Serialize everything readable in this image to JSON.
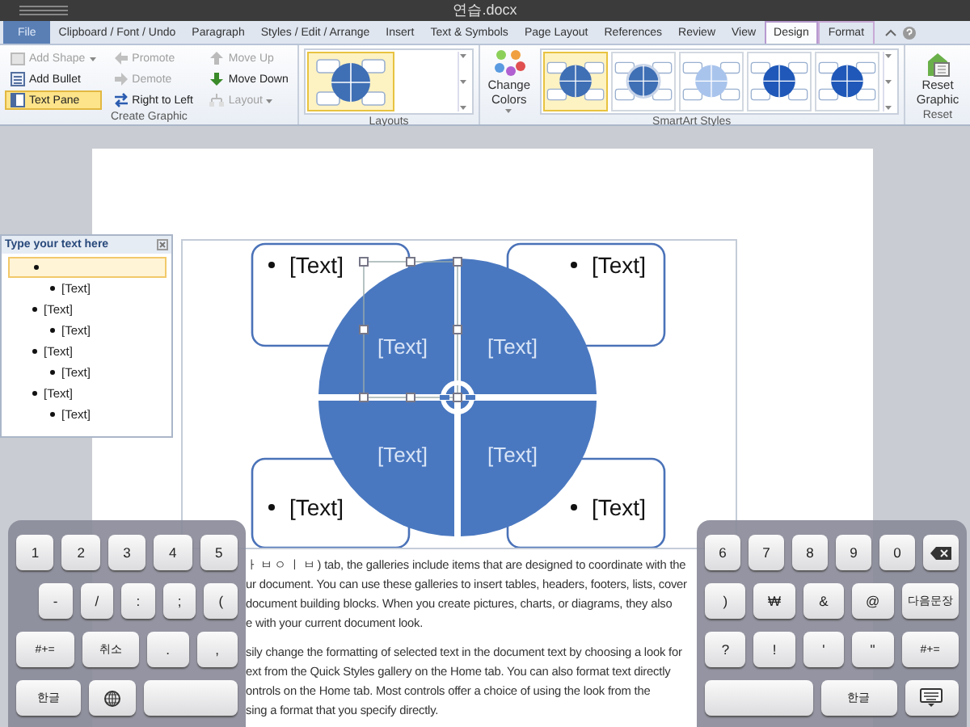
{
  "window": {
    "title": "연습.docx"
  },
  "tabs": [
    {
      "label": "File",
      "selected": false,
      "kind": "file"
    },
    {
      "label": "Clipboard / Font / Undo",
      "selected": false,
      "kind": "normal"
    },
    {
      "label": "Paragraph",
      "selected": false,
      "kind": "normal"
    },
    {
      "label": "Styles / Edit / Arrange",
      "selected": false,
      "kind": "normal"
    },
    {
      "label": "Insert",
      "selected": false,
      "kind": "normal"
    },
    {
      "label": "Text & Symbols",
      "selected": false,
      "kind": "normal"
    },
    {
      "label": "Page Layout",
      "selected": false,
      "kind": "normal"
    },
    {
      "label": "References",
      "selected": false,
      "kind": "normal"
    },
    {
      "label": "Review",
      "selected": false,
      "kind": "normal"
    },
    {
      "label": "View",
      "selected": false,
      "kind": "normal"
    },
    {
      "label": "Design",
      "selected": true,
      "kind": "contextual"
    },
    {
      "label": "Format",
      "selected": false,
      "kind": "contextual"
    }
  ],
  "create_graphic": {
    "label": "Create Graphic",
    "columns": [
      [
        {
          "label": "Add Shape",
          "kind": "shape",
          "disabled": true,
          "dropdown": true,
          "active": false
        },
        {
          "label": "Add Bullet",
          "kind": "bullet",
          "disabled": false,
          "dropdown": false,
          "active": false
        },
        {
          "label": "Text Pane",
          "kind": "pane",
          "disabled": false,
          "dropdown": false,
          "active": true
        }
      ],
      [
        {
          "label": "Promote",
          "kind": "left",
          "disabled": true,
          "dropdown": false,
          "active": false
        },
        {
          "label": "Demote",
          "kind": "right",
          "disabled": true,
          "dropdown": false,
          "active": false
        },
        {
          "label": "Right to Left",
          "kind": "swap",
          "disabled": false,
          "dropdown": false,
          "active": false
        }
      ],
      [
        {
          "label": "Move Up",
          "kind": "up",
          "disabled": true,
          "dropdown": false,
          "active": false
        },
        {
          "label": "Move Down",
          "kind": "down",
          "disabled": false,
          "dropdown": false,
          "active": false
        },
        {
          "label": "Layout",
          "kind": "org",
          "disabled": true,
          "dropdown": true,
          "active": false
        }
      ]
    ]
  },
  "layouts": {
    "label": "Layouts",
    "items": [
      {
        "selected": true
      }
    ]
  },
  "smartart_styles": {
    "label": "SmartArt Styles",
    "change_colors": "Change Colors",
    "styles": [
      {
        "selected": true,
        "kind": "flat"
      },
      {
        "selected": false,
        "kind": "ring"
      },
      {
        "selected": false,
        "kind": "light"
      },
      {
        "selected": false,
        "kind": "dark"
      },
      {
        "selected": false,
        "kind": "dark"
      }
    ]
  },
  "reset": {
    "label": "Reset",
    "button": "Reset Graphic"
  },
  "text_pane": {
    "title": "Type your text here",
    "items": [
      {
        "selected": true,
        "children": [
          {
            "text": "[Text]"
          }
        ]
      },
      {
        "text": "[Text]",
        "selected": false,
        "children": [
          {
            "text": "[Text]"
          }
        ]
      },
      {
        "text": "[Text]",
        "selected": false,
        "children": [
          {
            "text": "[Text]"
          }
        ]
      },
      {
        "text": "[Text]",
        "selected": false,
        "children": [
          {
            "text": "[Text]"
          }
        ]
      }
    ]
  },
  "smartart": {
    "quadrants": [
      "[Text]",
      "[Text]",
      "[Text]",
      "[Text]"
    ],
    "boxes": [
      "[Text]",
      "[Text]",
      "[Text]",
      "[Text]"
    ]
  },
  "document": {
    "paragraphs": [
      [
        "ㅏ ㅂ ㅇ ㅣ ㅂ ) tab, the galleries include items that are designed to coordinate with the",
        "ur document. You can use these galleries to insert tables, headers, footers, lists, cover",
        "document building blocks. When you create pictures, charts, or diagrams, they also",
        "e with your current document look."
      ],
      [
        "sily change the formatting of selected text in the document text by choosing a look for",
        "ext from the Quick Styles gallery on the Home tab. You can also format text directly",
        "ontrols on the Home tab. Most controls offer a choice of using the look from the",
        "sing a format that you specify directly."
      ]
    ]
  },
  "keyboard_left": [
    [
      {
        "kind": "key",
        "label": "1"
      },
      {
        "kind": "key",
        "label": "2"
      },
      {
        "kind": "key",
        "label": "3"
      },
      {
        "kind": "key",
        "label": "4"
      },
      {
        "kind": "key",
        "label": "5"
      }
    ],
    [
      {
        "kind": "key",
        "label": "-"
      },
      {
        "kind": "key",
        "label": "/"
      },
      {
        "kind": "key",
        "label": ":"
      },
      {
        "kind": "key",
        "label": ";"
      },
      {
        "kind": "key",
        "label": "("
      }
    ],
    [
      {
        "kind": "wide",
        "label": "#+="
      },
      {
        "kind": "wide",
        "label": "취소"
      },
      {
        "kind": "key",
        "label": "."
      },
      {
        "kind": "key",
        "label": ","
      }
    ],
    [
      {
        "kind": "wide",
        "label": "한글"
      },
      {
        "kind": "globe"
      },
      {
        "kind": "space"
      }
    ]
  ],
  "keyboard_right": [
    [
      {
        "kind": "key",
        "label": "6"
      },
      {
        "kind": "key",
        "label": "7"
      },
      {
        "kind": "key",
        "label": "8"
      },
      {
        "kind": "key",
        "label": "9"
      },
      {
        "kind": "key",
        "label": "0"
      },
      {
        "kind": "backspace"
      }
    ],
    [
      {
        "kind": "key",
        "label": ")"
      },
      {
        "kind": "key",
        "label": "₩"
      },
      {
        "kind": "key",
        "label": "&"
      },
      {
        "kind": "key",
        "label": "@"
      },
      {
        "kind": "wide",
        "label": "다음문장"
      }
    ],
    [
      {
        "kind": "key",
        "label": "?"
      },
      {
        "kind": "key",
        "label": "!"
      },
      {
        "kind": "key",
        "label": "'"
      },
      {
        "kind": "key",
        "label": "\""
      },
      {
        "kind": "wide",
        "label": "#+="
      }
    ],
    [
      {
        "kind": "space"
      },
      {
        "kind": "wide",
        "label": "한글"
      },
      {
        "kind": "hide"
      }
    ]
  ]
}
